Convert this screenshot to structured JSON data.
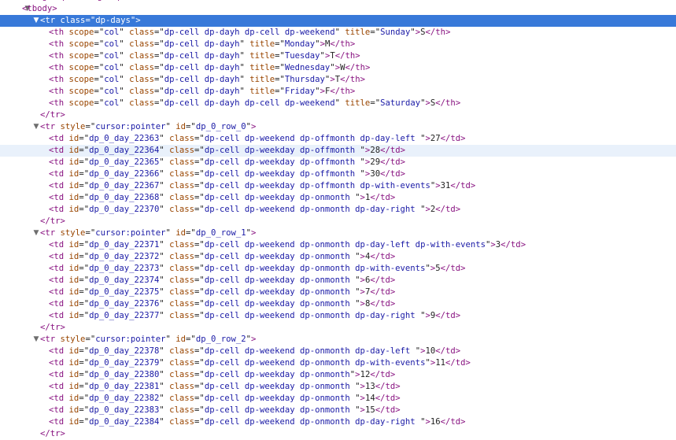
{
  "lines": [
    {
      "indent": 0,
      "arrow": "",
      "tag": "",
      "attrs": [],
      "text": "<colgroup></colgroup>",
      "tail": ""
    },
    {
      "indent": 0,
      "arrow": "down",
      "tag": "tbody",
      "attrs": [],
      "text": "",
      "tail": ""
    },
    {
      "indent": 1,
      "arrow": "down",
      "tag": "tr",
      "attrs": [
        {
          "n": "class",
          "v": "dp-days"
        }
      ],
      "text": "",
      "tail": "",
      "selected": true
    },
    {
      "indent": 2,
      "arrow": "",
      "tag": "th",
      "attrs": [
        {
          "n": "scope",
          "v": "col"
        },
        {
          "n": "class",
          "v": "dp-cell dp-dayh dp-cell dp-weekend"
        },
        {
          "n": "title",
          "v": "Sunday"
        }
      ],
      "text": "S",
      "tail": "th"
    },
    {
      "indent": 2,
      "arrow": "",
      "tag": "th",
      "attrs": [
        {
          "n": "scope",
          "v": "col"
        },
        {
          "n": "class",
          "v": "dp-cell dp-dayh"
        },
        {
          "n": "title",
          "v": "Monday"
        }
      ],
      "text": "M",
      "tail": "th"
    },
    {
      "indent": 2,
      "arrow": "",
      "tag": "th",
      "attrs": [
        {
          "n": "scope",
          "v": "col"
        },
        {
          "n": "class",
          "v": "dp-cell dp-dayh"
        },
        {
          "n": "title",
          "v": "Tuesday"
        }
      ],
      "text": "T",
      "tail": "th"
    },
    {
      "indent": 2,
      "arrow": "",
      "tag": "th",
      "attrs": [
        {
          "n": "scope",
          "v": "col"
        },
        {
          "n": "class",
          "v": "dp-cell dp-dayh"
        },
        {
          "n": "title",
          "v": "Wednesday"
        }
      ],
      "text": "W",
      "tail": "th"
    },
    {
      "indent": 2,
      "arrow": "",
      "tag": "th",
      "attrs": [
        {
          "n": "scope",
          "v": "col"
        },
        {
          "n": "class",
          "v": "dp-cell dp-dayh"
        },
        {
          "n": "title",
          "v": "Thursday"
        }
      ],
      "text": "T",
      "tail": "th"
    },
    {
      "indent": 2,
      "arrow": "",
      "tag": "th",
      "attrs": [
        {
          "n": "scope",
          "v": "col"
        },
        {
          "n": "class",
          "v": "dp-cell dp-dayh"
        },
        {
          "n": "title",
          "v": "Friday"
        }
      ],
      "text": "F",
      "tail": "th"
    },
    {
      "indent": 2,
      "arrow": "",
      "tag": "th",
      "attrs": [
        {
          "n": "scope",
          "v": "col"
        },
        {
          "n": "class",
          "v": "dp-cell dp-dayh dp-cell dp-weekend"
        },
        {
          "n": "title",
          "v": "Saturday"
        }
      ],
      "text": "S",
      "tail": "th"
    },
    {
      "indent": 1,
      "arrow": "",
      "tag": "",
      "attrs": [],
      "text": "",
      "tail": "tr",
      "close": true
    },
    {
      "indent": 1,
      "arrow": "down",
      "tag": "tr",
      "attrs": [
        {
          "n": "style",
          "v": "cursor:pointer"
        },
        {
          "n": "id",
          "v": "dp_0_row_0"
        }
      ],
      "text": "",
      "tail": ""
    },
    {
      "indent": 2,
      "arrow": "",
      "tag": "td",
      "attrs": [
        {
          "n": "id",
          "v": "dp_0_day_22363"
        },
        {
          "n": "class",
          "v": "dp-cell dp-weekend dp-offmonth dp-day-left "
        }
      ],
      "text": "27",
      "tail": "td"
    },
    {
      "indent": 2,
      "arrow": "",
      "tag": "td",
      "attrs": [
        {
          "n": "id",
          "v": "dp_0_day_22364"
        },
        {
          "n": "class",
          "v": "dp-cell dp-weekday dp-offmonth "
        }
      ],
      "text": "28",
      "tail": "td",
      "hover": true
    },
    {
      "indent": 2,
      "arrow": "",
      "tag": "td",
      "attrs": [
        {
          "n": "id",
          "v": "dp_0_day_22365"
        },
        {
          "n": "class",
          "v": "dp-cell dp-weekday dp-offmonth "
        }
      ],
      "text": "29",
      "tail": "td"
    },
    {
      "indent": 2,
      "arrow": "",
      "tag": "td",
      "attrs": [
        {
          "n": "id",
          "v": "dp_0_day_22366"
        },
        {
          "n": "class",
          "v": "dp-cell dp-weekday dp-offmonth "
        }
      ],
      "text": "30",
      "tail": "td"
    },
    {
      "indent": 2,
      "arrow": "",
      "tag": "td",
      "attrs": [
        {
          "n": "id",
          "v": "dp_0_day_22367"
        },
        {
          "n": "class",
          "v": "dp-cell dp-weekday dp-offmonth dp-with-events"
        }
      ],
      "text": "31",
      "tail": "td"
    },
    {
      "indent": 2,
      "arrow": "",
      "tag": "td",
      "attrs": [
        {
          "n": "id",
          "v": "dp_0_day_22368"
        },
        {
          "n": "class",
          "v": "dp-cell dp-weekday dp-onmonth "
        }
      ],
      "text": "1",
      "tail": "td"
    },
    {
      "indent": 2,
      "arrow": "",
      "tag": "td",
      "attrs": [
        {
          "n": "id",
          "v": "dp_0_day_22370"
        },
        {
          "n": "class",
          "v": "dp-cell dp-weekend dp-onmonth dp-day-right "
        }
      ],
      "text": "2",
      "tail": "td"
    },
    {
      "indent": 1,
      "arrow": "",
      "tag": "",
      "attrs": [],
      "text": "",
      "tail": "tr",
      "close": true
    },
    {
      "indent": 1,
      "arrow": "down",
      "tag": "tr",
      "attrs": [
        {
          "n": "style",
          "v": "cursor:pointer"
        },
        {
          "n": "id",
          "v": "dp_0_row_1"
        }
      ],
      "text": "",
      "tail": ""
    },
    {
      "indent": 2,
      "arrow": "",
      "tag": "td",
      "attrs": [
        {
          "n": "id",
          "v": "dp_0_day_22371"
        },
        {
          "n": "class",
          "v": "dp-cell dp-weekend dp-onmonth dp-day-left dp-with-events"
        }
      ],
      "text": "3",
      "tail": "td"
    },
    {
      "indent": 2,
      "arrow": "",
      "tag": "td",
      "attrs": [
        {
          "n": "id",
          "v": "dp_0_day_22372"
        },
        {
          "n": "class",
          "v": "dp-cell dp-weekday dp-onmonth "
        }
      ],
      "text": "4",
      "tail": "td"
    },
    {
      "indent": 2,
      "arrow": "",
      "tag": "td",
      "attrs": [
        {
          "n": "id",
          "v": "dp_0_day_22373"
        },
        {
          "n": "class",
          "v": "dp-cell dp-weekday dp-onmonth dp-with-events"
        }
      ],
      "text": "5",
      "tail": "td"
    },
    {
      "indent": 2,
      "arrow": "",
      "tag": "td",
      "attrs": [
        {
          "n": "id",
          "v": "dp_0_day_22374"
        },
        {
          "n": "class",
          "v": "dp-cell dp-weekday dp-onmonth "
        }
      ],
      "text": "6",
      "tail": "td"
    },
    {
      "indent": 2,
      "arrow": "",
      "tag": "td",
      "attrs": [
        {
          "n": "id",
          "v": "dp_0_day_22375"
        },
        {
          "n": "class",
          "v": "dp-cell dp-weekday dp-onmonth "
        }
      ],
      "text": "7",
      "tail": "td"
    },
    {
      "indent": 2,
      "arrow": "",
      "tag": "td",
      "attrs": [
        {
          "n": "id",
          "v": "dp_0_day_22376"
        },
        {
          "n": "class",
          "v": "dp-cell dp-weekday dp-onmonth "
        }
      ],
      "text": "8",
      "tail": "td"
    },
    {
      "indent": 2,
      "arrow": "",
      "tag": "td",
      "attrs": [
        {
          "n": "id",
          "v": "dp_0_day_22377"
        },
        {
          "n": "class",
          "v": "dp-cell dp-weekend dp-onmonth dp-day-right "
        }
      ],
      "text": "9",
      "tail": "td"
    },
    {
      "indent": 1,
      "arrow": "",
      "tag": "",
      "attrs": [],
      "text": "",
      "tail": "tr",
      "close": true
    },
    {
      "indent": 1,
      "arrow": "down",
      "tag": "tr",
      "attrs": [
        {
          "n": "style",
          "v": "cursor:pointer"
        },
        {
          "n": "id",
          "v": "dp_0_row_2"
        }
      ],
      "text": "",
      "tail": ""
    },
    {
      "indent": 2,
      "arrow": "",
      "tag": "td",
      "attrs": [
        {
          "n": "id",
          "v": "dp_0_day_22378"
        },
        {
          "n": "class",
          "v": "dp-cell dp-weekend dp-onmonth dp-day-left "
        }
      ],
      "text": "10",
      "tail": "td"
    },
    {
      "indent": 2,
      "arrow": "",
      "tag": "td",
      "attrs": [
        {
          "n": "id",
          "v": "dp_0_day_22379"
        },
        {
          "n": "class",
          "v": "dp-cell dp-weekend dp-onmonth dp-with-events"
        }
      ],
      "text": "11",
      "tail": "td"
    },
    {
      "indent": 2,
      "arrow": "",
      "tag": "td",
      "attrs": [
        {
          "n": "id",
          "v": "dp_0_day_22380"
        },
        {
          "n": "class",
          "v": "dp-cell dp-weekday dp-onmonth"
        }
      ],
      "text": "12",
      "tail": "td"
    },
    {
      "indent": 2,
      "arrow": "",
      "tag": "td",
      "attrs": [
        {
          "n": "id",
          "v": "dp_0_day_22381"
        },
        {
          "n": "class",
          "v": "dp-cell dp-weekday dp-onmonth "
        }
      ],
      "text": "13",
      "tail": "td"
    },
    {
      "indent": 2,
      "arrow": "",
      "tag": "td",
      "attrs": [
        {
          "n": "id",
          "v": "dp_0_day_22382"
        },
        {
          "n": "class",
          "v": "dp-cell dp-weekday dp-onmonth "
        }
      ],
      "text": "14",
      "tail": "td"
    },
    {
      "indent": 2,
      "arrow": "",
      "tag": "td",
      "attrs": [
        {
          "n": "id",
          "v": "dp_0_day_22383"
        },
        {
          "n": "class",
          "v": "dp-cell dp-weekday dp-onmonth "
        }
      ],
      "text": "15",
      "tail": "td"
    },
    {
      "indent": 2,
      "arrow": "",
      "tag": "td",
      "attrs": [
        {
          "n": "id",
          "v": "dp_0_day_22384"
        },
        {
          "n": "class",
          "v": "dp-cell dp-weekend dp-onmonth dp-day-right "
        }
      ],
      "text": "16",
      "tail": "td"
    },
    {
      "indent": 1,
      "arrow": "",
      "tag": "",
      "attrs": [],
      "text": "",
      "tail": "tr",
      "close": true
    }
  ],
  "colors": {
    "tag": "#881280",
    "attr_name": "#994500",
    "attr_value": "#1a1aa6",
    "selection": "#3879d9",
    "hover": "#e9f1fb"
  }
}
